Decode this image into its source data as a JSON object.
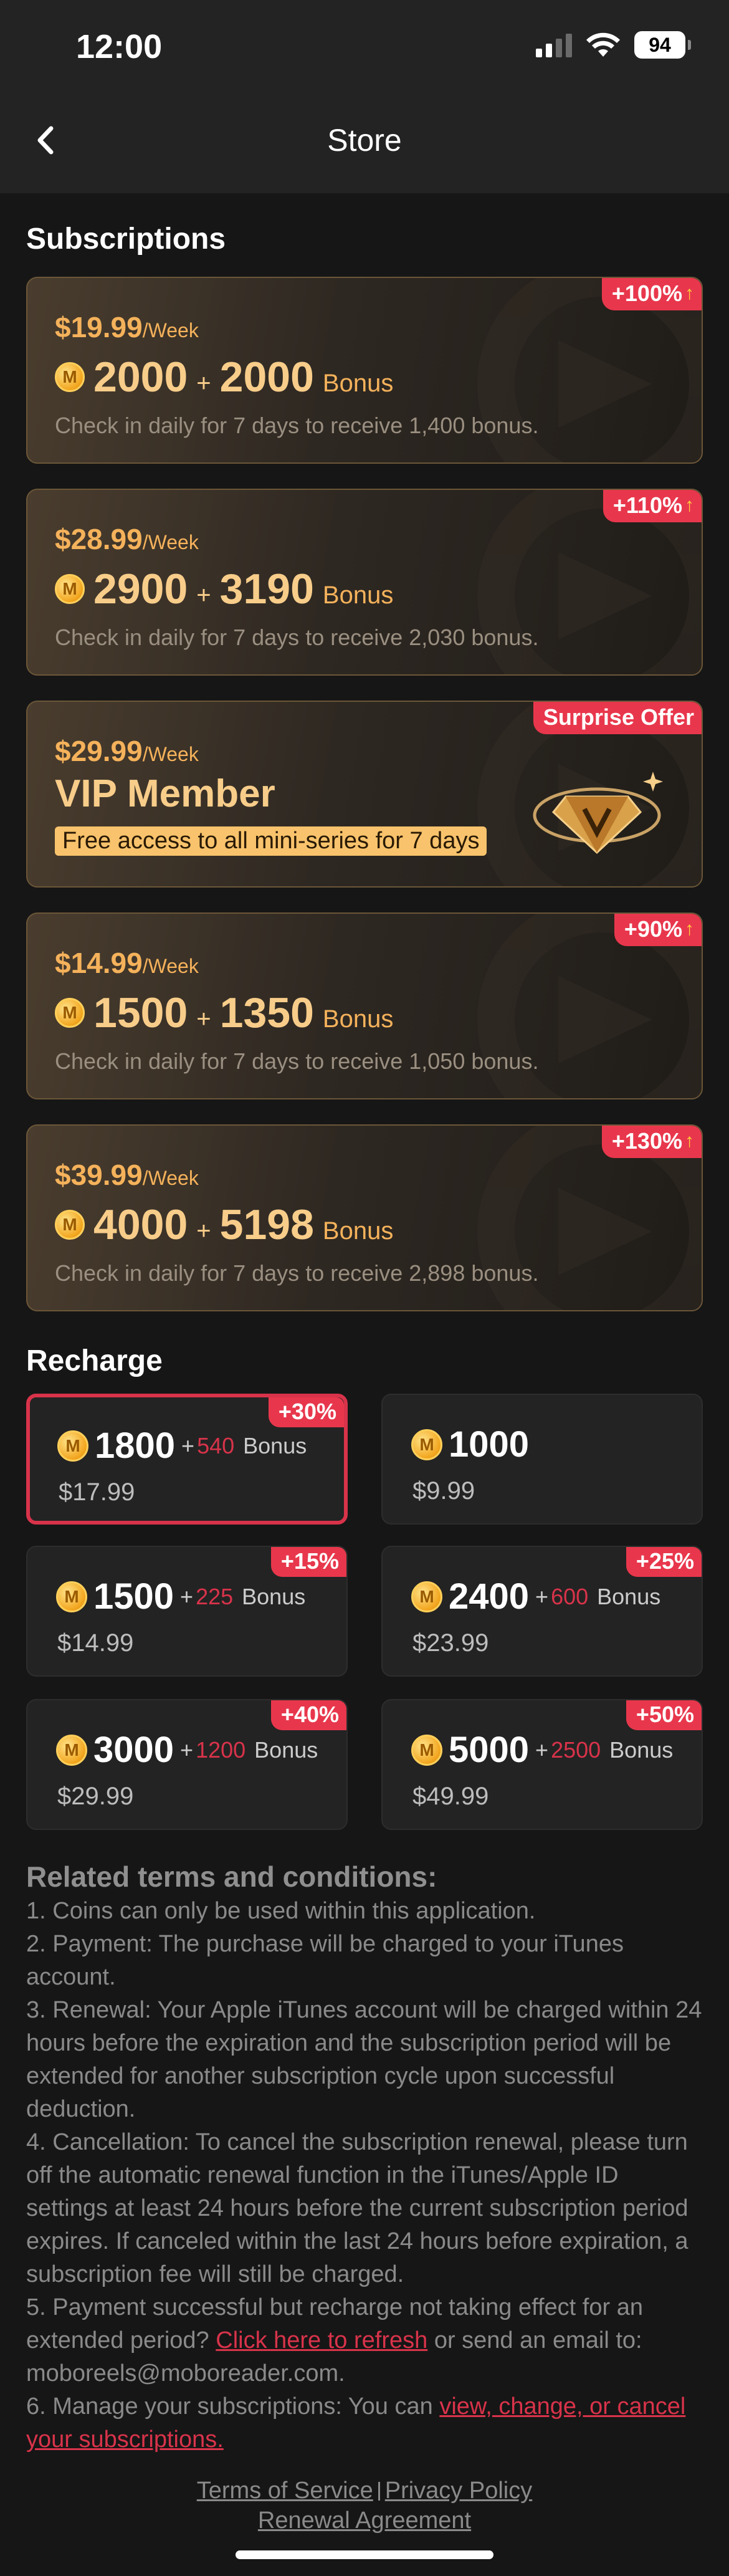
{
  "status_bar": {
    "time": "12:00",
    "battery": "94"
  },
  "header": {
    "title": "Store"
  },
  "subscriptions": {
    "title": "Subscriptions",
    "cards": [
      {
        "price": "$19.99",
        "period": "/Week",
        "coins": "2000",
        "bonus": "2000",
        "bonus_word": "Bonus",
        "desc": "Check in daily for 7 days to receive 1,400 bonus.",
        "badge": "+100%"
      },
      {
        "price": "$28.99",
        "period": "/Week",
        "coins": "2900",
        "bonus": "3190",
        "bonus_word": "Bonus",
        "desc": "Check in daily for 7 days to receive 2,030 bonus.",
        "badge": "+110%"
      },
      {
        "price": "$29.99",
        "period": "/Week",
        "title": "VIP Member",
        "tag": "Free access to all mini-series for 7 days",
        "badge": "Surprise Offer"
      },
      {
        "price": "$14.99",
        "period": "/Week",
        "coins": "1500",
        "bonus": "1350",
        "bonus_word": "Bonus",
        "desc": "Check in daily for 7 days to receive 1,050 bonus.",
        "badge": "+90%"
      },
      {
        "price": "$39.99",
        "period": "/Week",
        "coins": "4000",
        "bonus": "5198",
        "bonus_word": "Bonus",
        "desc": "Check in daily for 7 days to receive 2,898 bonus.",
        "badge": "+130%"
      }
    ]
  },
  "recharge": {
    "title": "Recharge",
    "items": [
      {
        "coins": "1800",
        "plus": "+",
        "bonus": "540",
        "bonus_word": "Bonus",
        "price": "$17.99",
        "badge": "+30%"
      },
      {
        "coins": "1000",
        "price": "$9.99"
      },
      {
        "coins": "1500",
        "plus": "+",
        "bonus": "225",
        "bonus_word": "Bonus",
        "price": "$14.99",
        "badge": "+15%"
      },
      {
        "coins": "2400",
        "plus": "+",
        "bonus": "600",
        "bonus_word": "Bonus",
        "price": "$23.99",
        "badge": "+25%"
      },
      {
        "coins": "3000",
        "plus": "+",
        "bonus": "1200",
        "bonus_word": "Bonus",
        "price": "$29.99",
        "badge": "+40%"
      },
      {
        "coins": "5000",
        "plus": "+",
        "bonus": "2500",
        "bonus_word": "Bonus",
        "price": "$49.99",
        "badge": "+50%"
      }
    ]
  },
  "terms": {
    "title": "Related terms and conditions:",
    "item1": "1. Coins can only be used within this application.",
    "item2": "2. Payment: The purchase will be charged to your iTunes account.",
    "item3": "3. Renewal: Your Apple iTunes account will be charged within 24 hours before the expiration and the subscription period will be extended for another subscription cycle upon successful deduction.",
    "item4": "4. Cancellation: To cancel the subscription renewal, please turn off the automatic renewal function in the iTunes/Apple ID settings at least 24 hours before the current subscription period expires. If canceled within the last 24 hours before expiration, a subscription fee will still be charged.",
    "item5_a": "5. Payment successful but recharge not taking effect for an extended period? ",
    "item5_link": "Click here to refresh",
    "item5_b": " or send an email to: moboreels@moboreader.com.",
    "item6_a": "6. Manage your subscriptions: You can ",
    "item6_link": "view, change, or cancel your subscriptions."
  },
  "footer": {
    "terms_of_service": "Terms of Service",
    "privacy_policy": "Privacy Policy",
    "renewal_agreement": "Renewal Agreement"
  },
  "icons": {
    "back": "chevron-left-icon",
    "coin": "coin-icon",
    "gem": "vip-gem-icon"
  },
  "colors": {
    "accent_red": "#e8374c",
    "gold": "#f5b25b",
    "background": "#161616"
  }
}
